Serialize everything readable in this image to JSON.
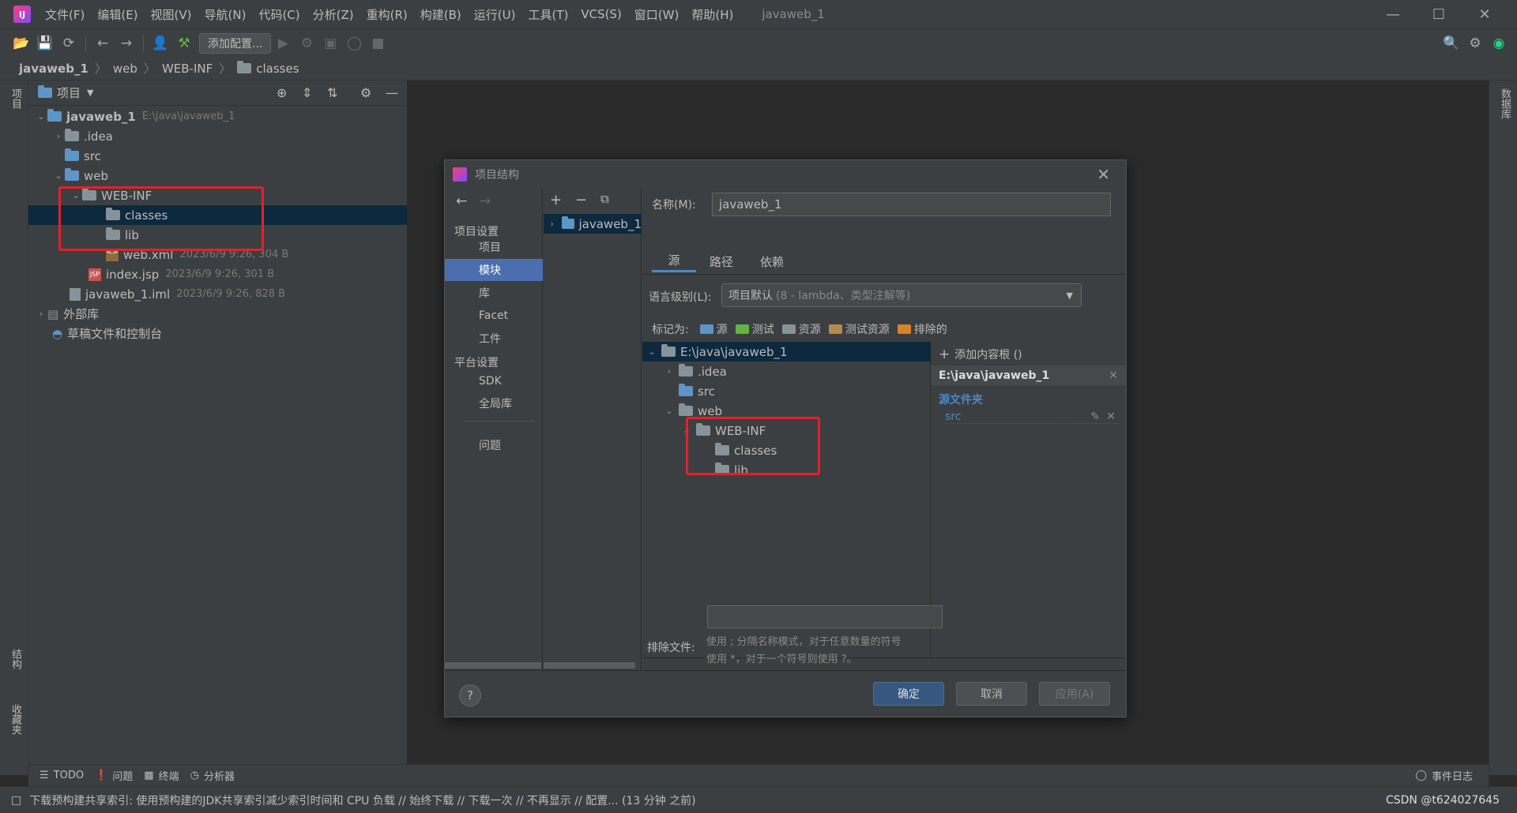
{
  "menu": {
    "items": [
      "文件(F)",
      "编辑(E)",
      "视图(V)",
      "导航(N)",
      "代码(C)",
      "分析(Z)",
      "重构(R)",
      "构建(B)",
      "运行(U)",
      "工具(T)",
      "VCS(S)",
      "窗口(W)",
      "帮助(H)"
    ],
    "window_title": "javaweb_1"
  },
  "toolbar": {
    "add_config": "添加配置..."
  },
  "breadcrumb": [
    "javaweb_1",
    "web",
    "WEB-INF",
    "classes"
  ],
  "side_tabs": {
    "project": "项目",
    "structure": "结构",
    "favorites": "收藏夹",
    "database": "数据库"
  },
  "project_panel": {
    "title": "项目",
    "tree": [
      {
        "label": "javaweb_1",
        "meta": "E:\\java\\javaweb_1"
      },
      {
        "label": ".idea"
      },
      {
        "label": "src"
      },
      {
        "label": "web"
      },
      {
        "label": "WEB-INF"
      },
      {
        "label": "classes"
      },
      {
        "label": "lib"
      },
      {
        "label": "web.xml",
        "meta": "2023/6/9 9:26, 304 B"
      },
      {
        "label": "index.jsp",
        "meta": "2023/6/9 9:26, 301 B"
      },
      {
        "label": "javaweb_1.iml",
        "meta": "2023/6/9 9:26, 828 B"
      },
      {
        "label": "外部库"
      },
      {
        "label": "草稿文件和控制台"
      }
    ]
  },
  "dialog": {
    "title": "项目结构",
    "nav": {
      "project_settings": "项目设置",
      "project": "项目",
      "modules": "模块",
      "libraries": "库",
      "facets": "Facet",
      "artifacts": "工件",
      "platform_settings": "平台设置",
      "sdk": "SDK",
      "global_libs": "全局库",
      "problems": "问题"
    },
    "module": "javaweb_1",
    "name_label": "名称(M):",
    "name_value": "javaweb_1",
    "tabs": [
      "源",
      "路径",
      "依赖"
    ],
    "lang_label": "语言级别(L):",
    "lang_value": "项目默认",
    "lang_hint": "(8 - lambda、类型注解等)",
    "mark_label": "标记为:",
    "marks": [
      "源",
      "测试",
      "资源",
      "测试资源",
      "排除的"
    ],
    "mark_colors": [
      "#5e95c7",
      "#62b543",
      "#87939a",
      "#b58a4c",
      "#d9822b"
    ],
    "tree": [
      "E:\\java\\javaweb_1",
      ".idea",
      "src",
      "web",
      "WEB-INF",
      "classes",
      "lib"
    ],
    "add_root": "添加内容根 ()",
    "root_path": "E:\\java\\javaweb_1",
    "src_folders": "源文件夹",
    "src_item": "src",
    "exclude_label": "排除文件:",
    "hint1": "使用 ; 分隔名称模式，对于任意数量的符号",
    "hint2": "使用 *，对于一个符号则使用 ?。",
    "ok": "确定",
    "cancel": "取消",
    "apply": "应用(A)",
    "help": "?"
  },
  "bottom_tools": [
    "TODO",
    "问题",
    "终端",
    "分析器"
  ],
  "event_log": "事件日志",
  "status": "下载预构建共享索引: 使用预构建的JDK共享索引减少索引时间和 CPU 负载 // 始终下载 // 下载一次 // 不再显示 // 配置... (13 分钟 之前)",
  "watermark": "CSDN @t624027645"
}
